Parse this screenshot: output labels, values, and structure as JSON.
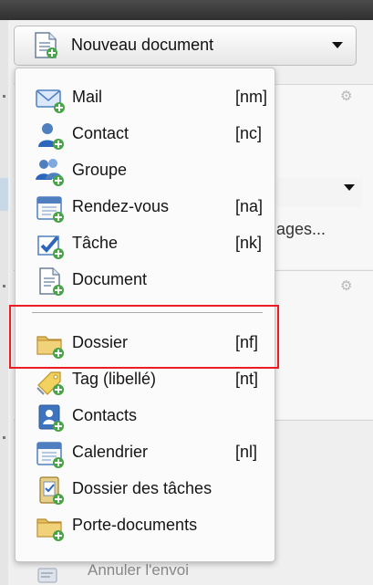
{
  "new_document_button": {
    "label": "Nouveau document"
  },
  "menu": {
    "items": [
      {
        "label": "Mail",
        "shortcut": "[nm]",
        "icon": "mail-icon"
      },
      {
        "label": "Contact",
        "shortcut": "[nc]",
        "icon": "contact-icon"
      },
      {
        "label": "Groupe",
        "shortcut": "",
        "icon": "group-icon"
      },
      {
        "label": "Rendez-vous",
        "shortcut": "[na]",
        "icon": "calendar-icon"
      },
      {
        "label": "Tâche",
        "shortcut": "[nk]",
        "icon": "task-icon"
      },
      {
        "label": "Document",
        "shortcut": "",
        "icon": "document-icon"
      },
      {
        "label": "Dossier",
        "shortcut": "[nf]",
        "icon": "folder-icon"
      },
      {
        "label": "Tag (libellé)",
        "shortcut": "[nt]",
        "icon": "tag-icon"
      },
      {
        "label": "Contacts",
        "shortcut": "",
        "icon": "address-book-icon"
      },
      {
        "label": "Calendrier",
        "shortcut": "[nl]",
        "icon": "calendar-icon"
      },
      {
        "label": "Dossier des tâches",
        "shortcut": "",
        "icon": "task-folder-icon"
      },
      {
        "label": "Porte-documents",
        "shortcut": "",
        "icon": "briefcase-folder-icon"
      }
    ]
  },
  "background": {
    "partial_text": "ages...",
    "bottom_text": "Annuler l'envoi"
  },
  "colors": {
    "highlight": "#ea1c24",
    "menu_background": "#fbfbfb",
    "blue_icon": "#4f7fbe",
    "folder_icon": "#e4bf5e"
  }
}
